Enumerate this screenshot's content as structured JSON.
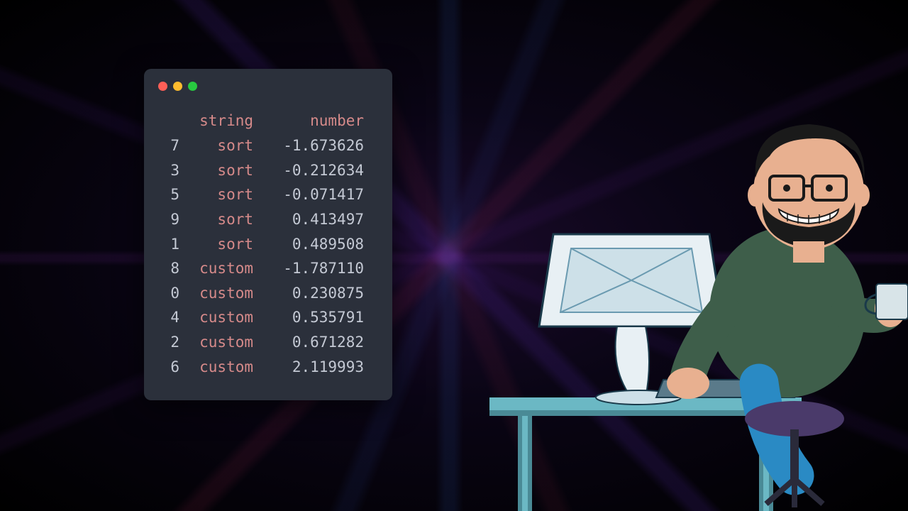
{
  "terminal": {
    "headers": {
      "string": "string",
      "number": "number"
    },
    "rows": [
      {
        "index": "7",
        "string": "sort",
        "number": "-1.673626"
      },
      {
        "index": "3",
        "string": "sort",
        "number": "-0.212634"
      },
      {
        "index": "5",
        "string": "sort",
        "number": "-0.071417"
      },
      {
        "index": "9",
        "string": "sort",
        "number": " 0.413497"
      },
      {
        "index": "1",
        "string": "sort",
        "number": " 0.489508"
      },
      {
        "index": "8",
        "string": "custom",
        "number": "-1.787110"
      },
      {
        "index": "0",
        "string": "custom",
        "number": " 0.230875"
      },
      {
        "index": "4",
        "string": "custom",
        "number": " 0.535791"
      },
      {
        "index": "2",
        "string": "custom",
        "number": " 0.671282"
      },
      {
        "index": "6",
        "string": "custom",
        "number": " 2.119993"
      }
    ]
  }
}
